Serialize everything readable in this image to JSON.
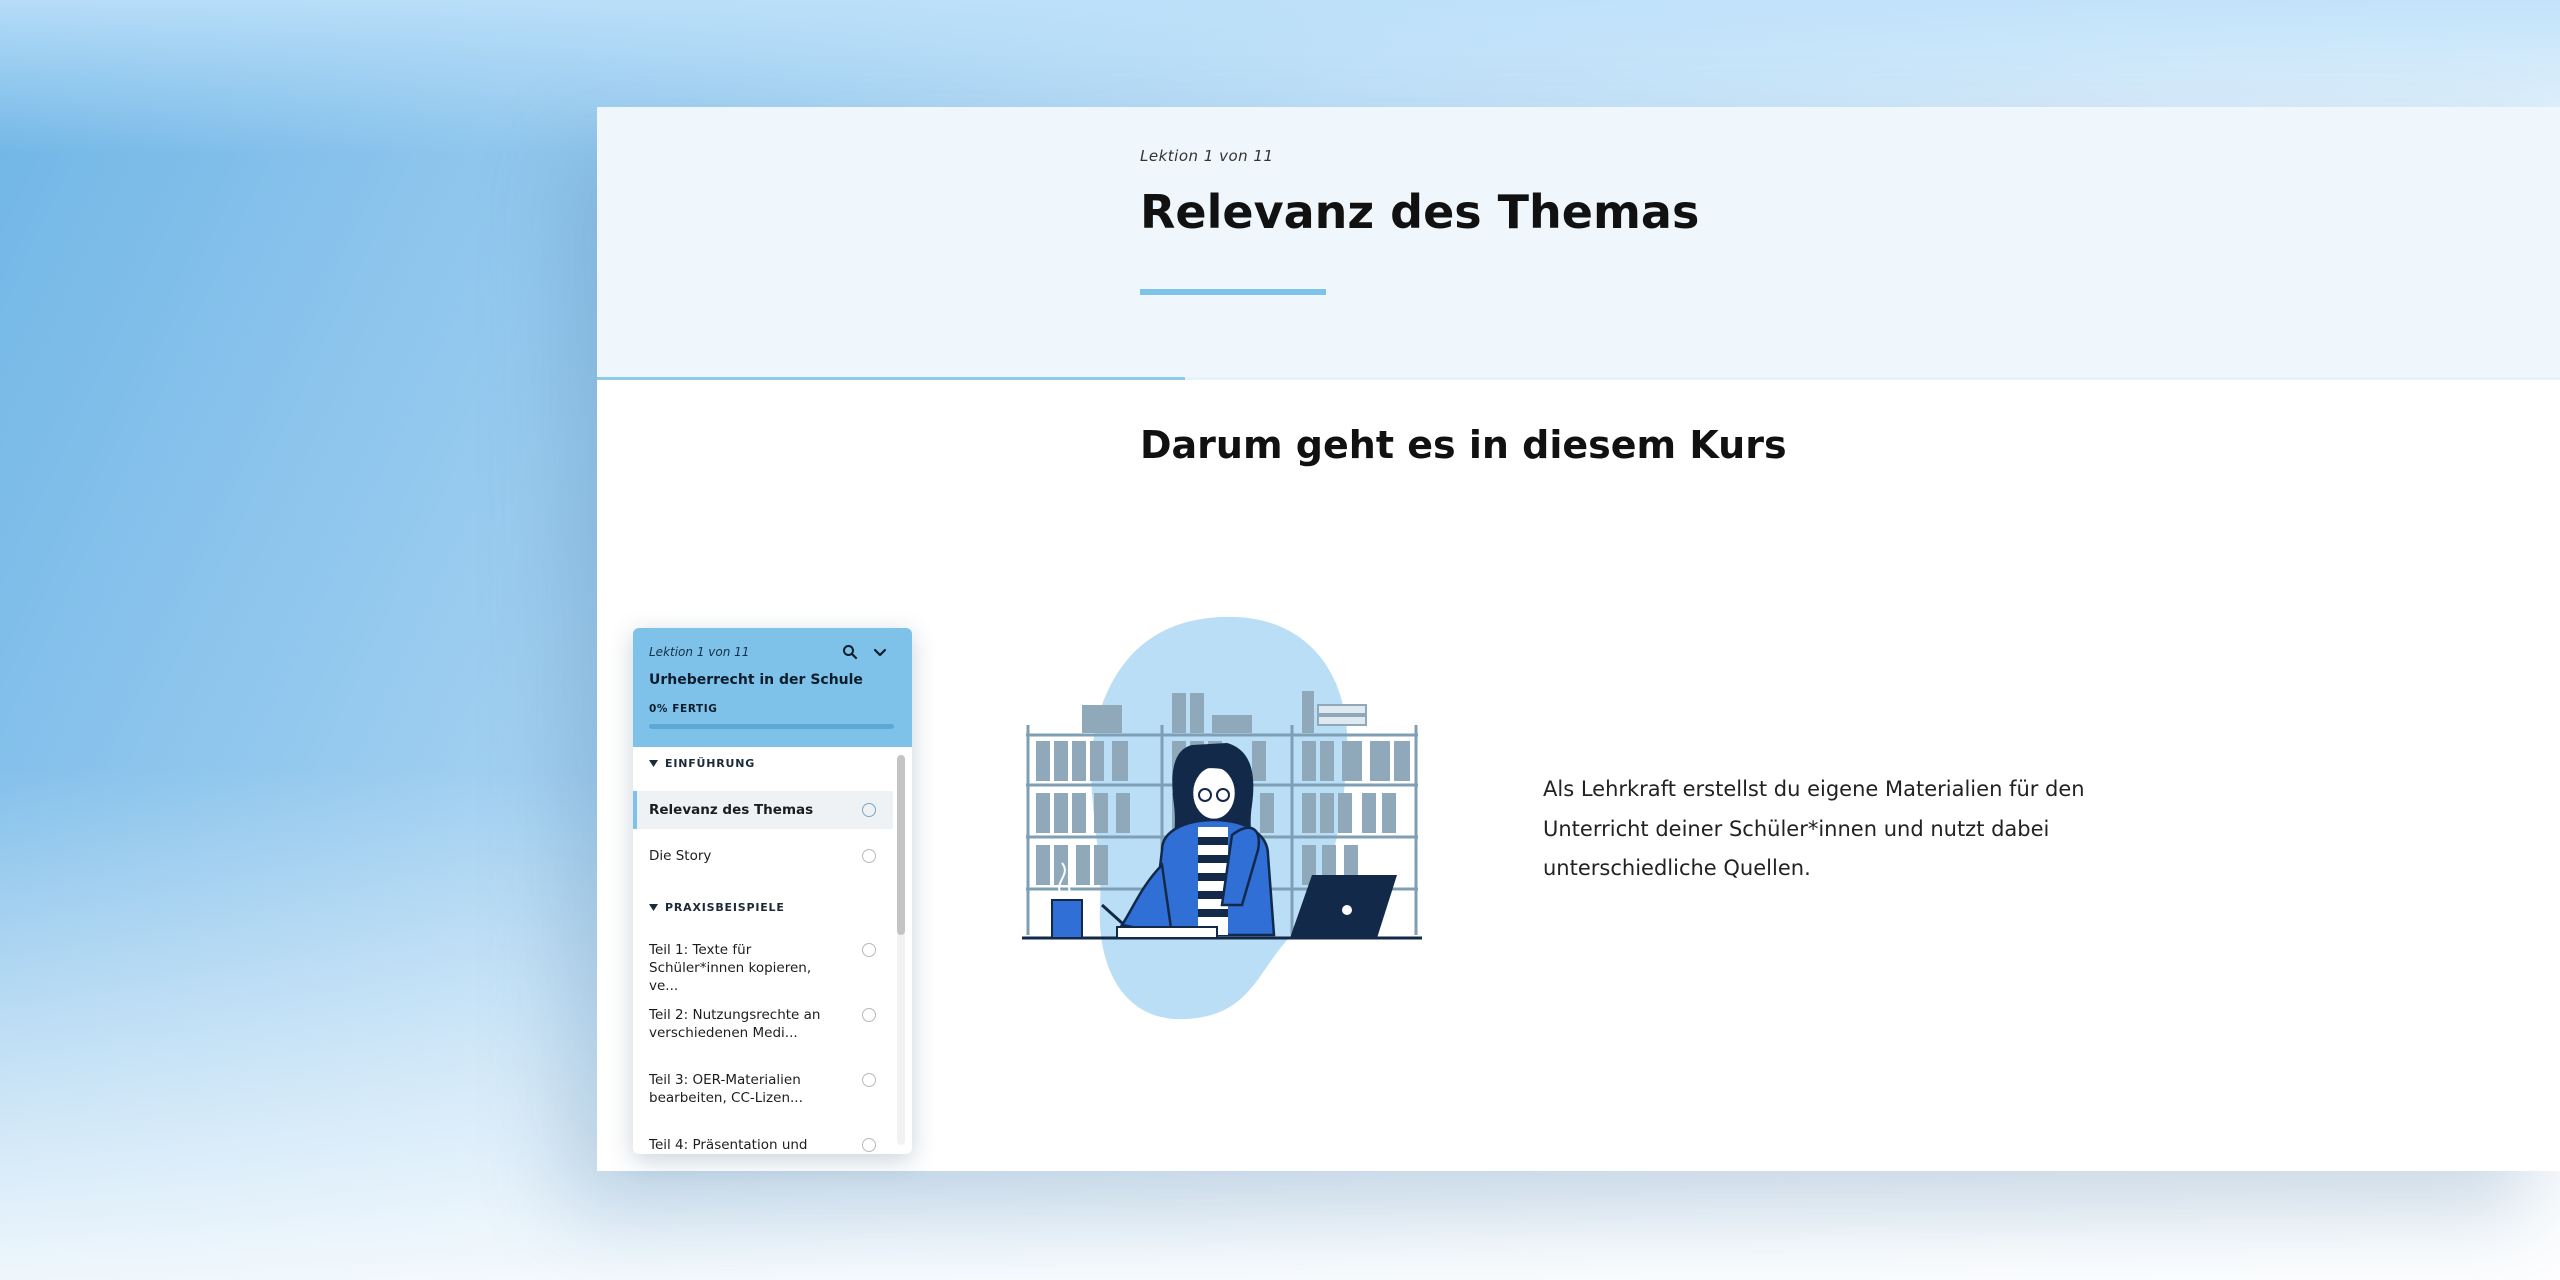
{
  "lesson": {
    "counter": "Lektion 1 von 11",
    "title": "Relevanz des Themas"
  },
  "content": {
    "heading": "Darum geht es in diesem Kurs",
    "paragraph": "Als Lehrkraft erstellst du eigene Materialien für den Unterricht deiner Schüler*innen und nutzt dabei unterschiedliche Quellen."
  },
  "nav": {
    "counter": "Lektion 1 von 11",
    "course_title": "Urheberrecht in der Schule",
    "progress_label": "0% FERTIG",
    "progress_value": 0,
    "search_icon": "search-icon",
    "collapse_icon": "chevron-down-icon",
    "sections": [
      {
        "title": "EINFÜHRUNG",
        "items": [
          {
            "label": "Relevanz des Themas",
            "active": true
          },
          {
            "label": "Die Story",
            "active": false
          }
        ]
      },
      {
        "title": "PRAXISBEISPIELE",
        "items": [
          {
            "label": "Teil 1: Texte für Schüler*innen kopieren, ve...",
            "active": false
          },
          {
            "label": "Teil 2: Nutzungsrechte an verschiedenen Medi...",
            "active": false
          },
          {
            "label": "Teil 3: OER-Materialien bearbeiten, CC-Lizen...",
            "active": false
          },
          {
            "label": "Teil 4: Präsentation und",
            "active": false
          }
        ]
      }
    ]
  },
  "colors": {
    "accent": "#7ec2ea",
    "underline": "#7ec3e8",
    "illustration_blob": "#b9def6",
    "illustration_blue": "#2f6fd6",
    "illustration_navy": "#13294a"
  }
}
